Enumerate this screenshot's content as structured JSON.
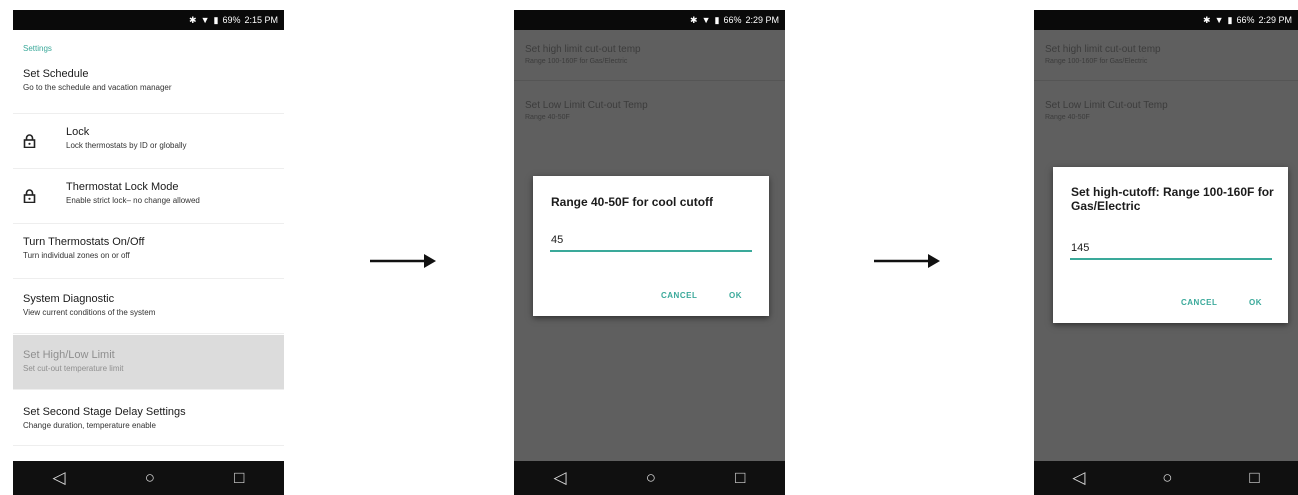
{
  "colors": {
    "accent": "#3aa99a",
    "status_bar": "#0a0a0a",
    "dim_overlay": "#5f5f5f"
  },
  "screen1": {
    "status_time": "2:15 PM",
    "status_battery": "69%",
    "section_header": "Settings",
    "items": [
      {
        "title": "Set Schedule",
        "subtitle": "Go to the schedule and vacation manager"
      },
      {
        "title": "Lock",
        "subtitle": "Lock thermostats by ID or globally",
        "icon": "lock-icon"
      },
      {
        "title": "Thermostat Lock Mode",
        "subtitle": "Enable strict lock– no change allowed",
        "icon": "lock-icon"
      },
      {
        "title": "Turn Thermostats On/Off",
        "subtitle": "Turn individual zones on or off"
      },
      {
        "title": "System Diagnostic",
        "subtitle": "View current conditions of the system"
      },
      {
        "title": "Set High/Low Limit",
        "subtitle": "Set cut-out temperature limit"
      },
      {
        "title": "Set Second Stage Delay Settings",
        "subtitle": "Change duration, temperature enable"
      }
    ]
  },
  "screen2": {
    "status_time": "2:29 PM",
    "status_battery": "66%",
    "bg_items": [
      {
        "title": "Set high limit cut-out temp",
        "subtitle": "Range 100-160F for Gas/Electric"
      },
      {
        "title": "Set Low Limit Cut-out Temp",
        "subtitle": "Range 40-50F"
      }
    ],
    "dialog": {
      "title": "Range 40-50F for cool cutoff",
      "value": "45",
      "cancel": "CANCEL",
      "ok": "OK"
    }
  },
  "screen3": {
    "status_time": "2:29 PM",
    "status_battery": "66%",
    "bg_items": [
      {
        "title": "Set high limit cut-out temp",
        "subtitle": "Range 100-160F for Gas/Electric"
      },
      {
        "title": "Set Low Limit Cut-out Temp",
        "subtitle": "Range 40-50F"
      }
    ],
    "dialog": {
      "title": "Set high-cutoff: Range 100-160F for Gas/Electric",
      "value": "145",
      "cancel": "CANCEL",
      "ok": "OK"
    }
  },
  "nav": {
    "back_icon": "back-triangle-icon",
    "home_icon": "home-circle-icon",
    "recents_icon": "recents-square-icon"
  }
}
